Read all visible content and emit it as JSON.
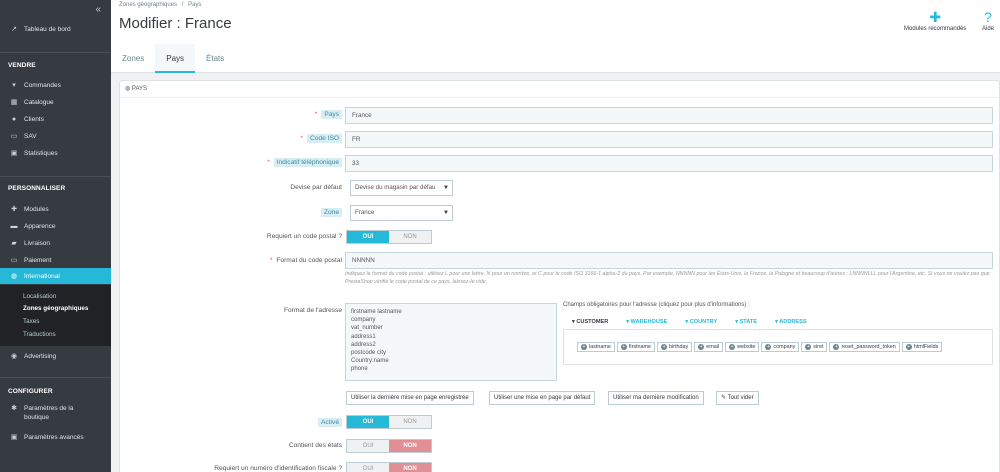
{
  "sidebar": {
    "collapse_icon": "double-chevron-left-icon",
    "dashboard": "Tableau de bord",
    "section_sell": "VENDRE",
    "sell_items": [
      {
        "label": "Commandes",
        "icon": "cart-icon"
      },
      {
        "label": "Catalogue",
        "icon": "store-icon"
      },
      {
        "label": "Clients",
        "icon": "user-icon"
      },
      {
        "label": "SAV",
        "icon": "chat-icon"
      },
      {
        "label": "Statistiques",
        "icon": "chart-icon"
      }
    ],
    "section_customize": "PERSONNALISER",
    "customize_items": [
      {
        "label": "Modules",
        "icon": "puzzle-icon"
      },
      {
        "label": "Apparence",
        "icon": "monitor-icon"
      },
      {
        "label": "Livraison",
        "icon": "truck-icon"
      },
      {
        "label": "Paiement",
        "icon": "card-icon"
      },
      {
        "label": "International",
        "icon": "globe-icon"
      }
    ],
    "international_sub": [
      "Localisation",
      "Zones géographiques",
      "Taxes",
      "Traductions"
    ],
    "advertising": "Advertising",
    "section_configure": "CONFIGURER",
    "shop_params": "Paramètres de la",
    "shop_params_2": "boutique",
    "advanced_params": "Paramètres avancés"
  },
  "header": {
    "breadcrumb_1": "Zones géographiques",
    "breadcrumb_sep": "/",
    "breadcrumb_2": "Pays",
    "title": "Modifier : France",
    "recommended_modules": "Modules recommandés",
    "help": "Aide",
    "tabs": [
      "Zones",
      "Pays",
      "États"
    ]
  },
  "panel": {
    "heading": "PAYS",
    "labels": {
      "country": "Pays",
      "iso": "Code ISO",
      "phone": "Indicatif téléphonique",
      "currency": "Devise par défaut",
      "zone": "Zone",
      "zip_required": "Requiert un code postal ?",
      "zip_format": "Format du code postal",
      "address_format": "Format de l'adresse",
      "active": "Activé",
      "contains_states": "Contient des états",
      "tax_id": "Requiert un numéro d'identification fiscale ?"
    },
    "values": {
      "country": "France",
      "iso": "FR",
      "phone": "33",
      "currency": "Devise du magasin par défau",
      "zone": "France",
      "zip_format": "NNNNN"
    },
    "toggle_yes": "OUI",
    "toggle_no": "NON",
    "help_text": "Indiquez le format du code postal : utilisez L pour une lettre, N pour un nombre, et C pour le code ISO 3166-1 alpha-2 du pays. Par exemple, NNNNN pour les États-Unis, la France, la Pologne et beaucoup d'autres ; LNNNNLLL pour l'Argentine, etc. Si vous ne voulez pas que PrestaShop vérifie le code postal de ce pays, laissez-le vide.",
    "address_lines": [
      "firstname lastname",
      "company",
      "vat_number",
      "address1",
      "address2",
      "postcode city",
      "Country:name",
      "phone"
    ],
    "required_fields_title": "Champs obligatoires pour l'adresse (cliquez pour plus d'informations) :",
    "field_tabs": [
      "CUSTOMER",
      "WAREHOUSE",
      "COUNTRY",
      "STATE",
      "ADDRESS"
    ],
    "chips": [
      "lastname",
      "firstname",
      "birthday",
      "email",
      "website",
      "company",
      "siret",
      "reset_password_token",
      "htmlFields"
    ],
    "buttons": {
      "last_saved": "Utiliser la dernière mise en page enregistrée",
      "default": "Utiliser une mise en page par défaut",
      "last_mine": "Utiliser ma dernière modification",
      "clear": "Tout vider"
    }
  }
}
